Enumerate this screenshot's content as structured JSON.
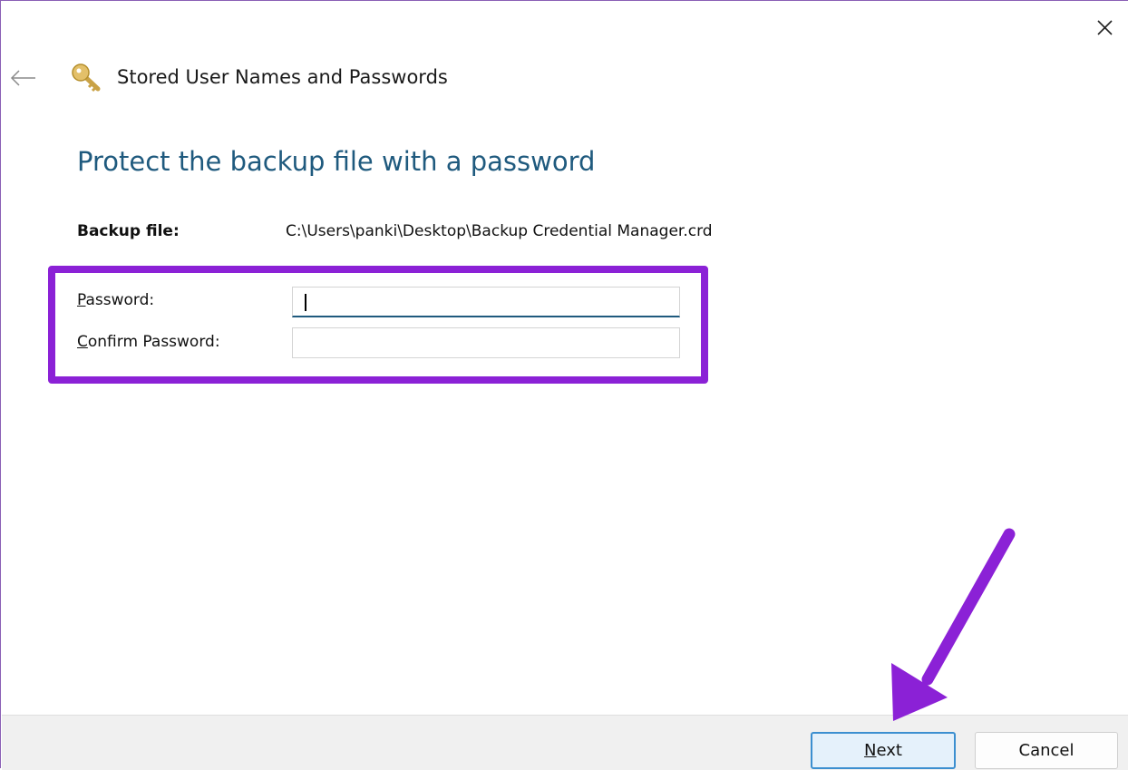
{
  "window": {
    "title": "Stored User Names and Passwords",
    "close_icon": "close-icon",
    "back_icon": "back-arrow-icon",
    "title_icon": "key-icon"
  },
  "page": {
    "heading": "Protect the backup file with a password",
    "backup_file": {
      "label": "Backup file:",
      "value": "C:\\Users\\panki\\Desktop\\Backup Credential Manager.crd"
    }
  },
  "form": {
    "password": {
      "label_accel": "P",
      "label_rest": "assword:",
      "value": ""
    },
    "confirm_password": {
      "label_accel": "C",
      "label_rest": "onfirm Password:",
      "value": ""
    }
  },
  "footer": {
    "next_accel": "N",
    "next_rest": "ext",
    "cancel_label": "Cancel"
  },
  "annotations": {
    "highlight_color": "#8b21d6",
    "arrow_color": "#8b21d6"
  }
}
